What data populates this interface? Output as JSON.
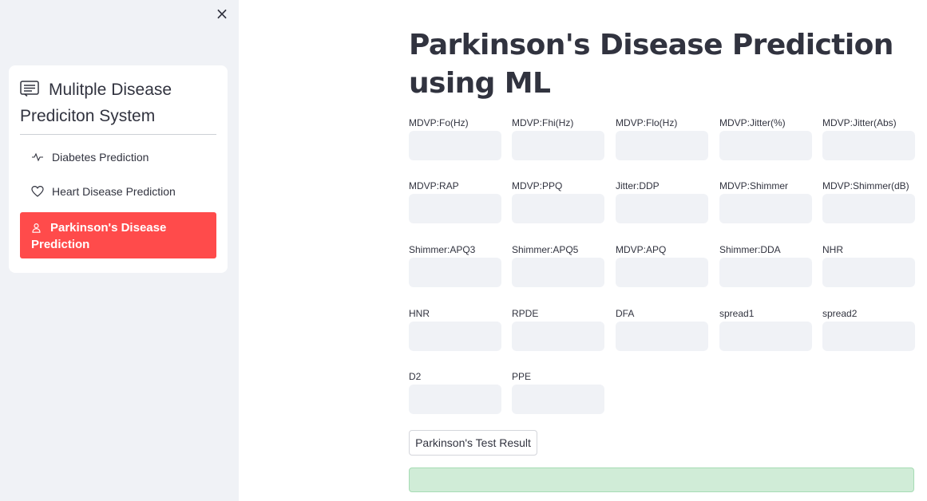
{
  "sidebar": {
    "close_label": "×",
    "title": "Mulitple Disease Prediciton System",
    "items": [
      {
        "label": "Diabetes Prediction",
        "icon": "activity-icon"
      },
      {
        "label": "Heart Disease Prediction",
        "icon": "heart-icon"
      },
      {
        "label": "Parkinson's Disease Prediction",
        "icon": "person-icon",
        "active": true
      }
    ]
  },
  "main": {
    "title": "Parkinson's Disease Prediction using ML",
    "fields": [
      {
        "label": "MDVP:Fo(Hz)",
        "value": ""
      },
      {
        "label": "MDVP:Fhi(Hz)",
        "value": ""
      },
      {
        "label": "MDVP:Flo(Hz)",
        "value": ""
      },
      {
        "label": "MDVP:Jitter(%)",
        "value": ""
      },
      {
        "label": "MDVP:Jitter(Abs)",
        "value": ""
      },
      {
        "label": "MDVP:RAP",
        "value": ""
      },
      {
        "label": "MDVP:PPQ",
        "value": ""
      },
      {
        "label": "Jitter:DDP",
        "value": ""
      },
      {
        "label": "MDVP:Shimmer",
        "value": ""
      },
      {
        "label": "MDVP:Shimmer(dB)",
        "value": ""
      },
      {
        "label": "Shimmer:APQ3",
        "value": ""
      },
      {
        "label": "Shimmer:APQ5",
        "value": ""
      },
      {
        "label": "MDVP:APQ",
        "value": ""
      },
      {
        "label": "Shimmer:DDA",
        "value": ""
      },
      {
        "label": "NHR",
        "value": ""
      },
      {
        "label": "HNR",
        "value": ""
      },
      {
        "label": "RPDE",
        "value": ""
      },
      {
        "label": "DFA",
        "value": ""
      },
      {
        "label": "spread1",
        "value": ""
      },
      {
        "label": "spread2",
        "value": ""
      },
      {
        "label": "D2",
        "value": ""
      },
      {
        "label": "PPE",
        "value": ""
      }
    ],
    "button_label": "Parkinson's Test Result",
    "result_text": ""
  },
  "colors": {
    "sidebar_bg": "#f0f2f6",
    "active_item": "#ff4b4b",
    "input_bg": "#f0f2f6",
    "success_bg": "#d0ecd7"
  }
}
